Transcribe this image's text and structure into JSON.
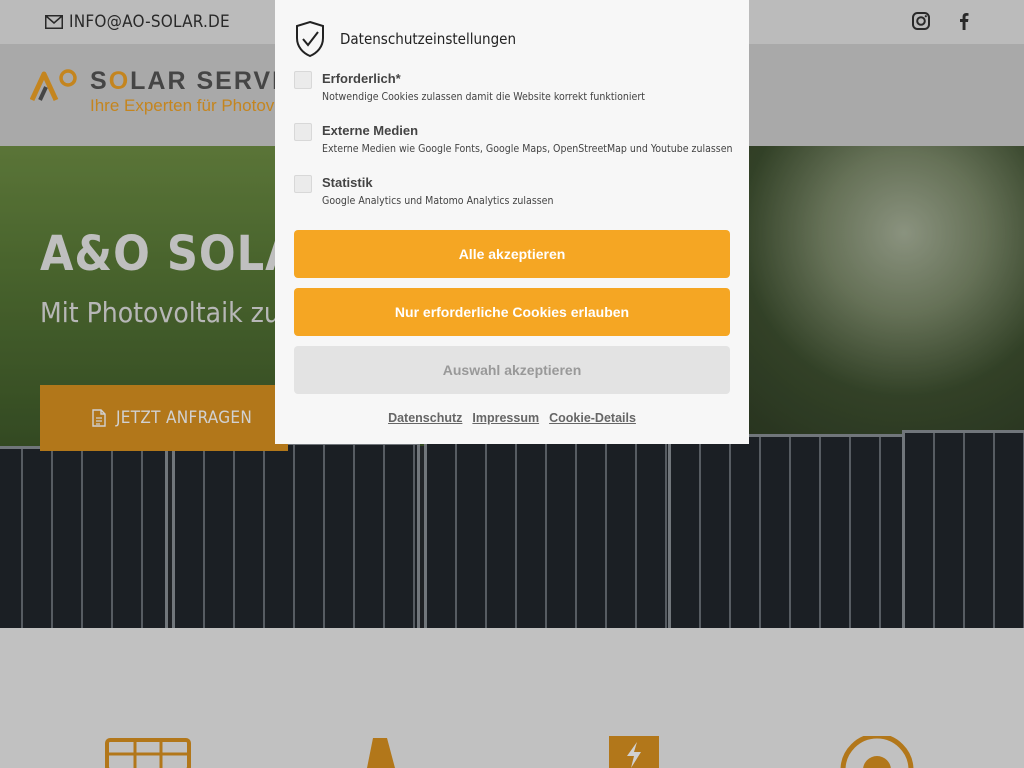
{
  "topbar": {
    "email": "INFO@AO-SOLAR.DE",
    "social": [
      {
        "name": "instagram-icon"
      },
      {
        "name": "facebook-icon"
      }
    ]
  },
  "logo": {
    "title_prefix": "S",
    "title_accent": "O",
    "title_rest": "LAR SERVIC",
    "subtitle": "Ihre Experten für Photovo"
  },
  "hero": {
    "title": "A&O SOLAR",
    "subtitle": "Mit Photovoltaik zu",
    "cta_label": "JETZT ANFRAGEN"
  },
  "modal": {
    "title": "Datenschutzeinstellungen",
    "options": [
      {
        "label": "Erforderlich*",
        "description": "Notwendige Cookies zulassen damit die Website korrekt funktioniert",
        "checked": false
      },
      {
        "label": "Externe Medien",
        "description": "Externe Medien wie Google Fonts, Google Maps, OpenStreetMap und Youtube zulassen",
        "checked": false
      },
      {
        "label": "Statistik",
        "description": "Google Analytics und Matomo Analytics zulassen",
        "checked": false
      }
    ],
    "buttons": {
      "accept_all": "Alle akzeptieren",
      "necessary_only": "Nur erforderliche Cookies erlauben",
      "accept_selection": "Auswahl akzeptieren"
    },
    "links": [
      "Datenschutz",
      "Impressum",
      "Cookie-Details"
    ]
  },
  "colors": {
    "accent": "#f5a623",
    "accent_dark": "#d99220",
    "button_disabled": "#e3e3e3"
  }
}
